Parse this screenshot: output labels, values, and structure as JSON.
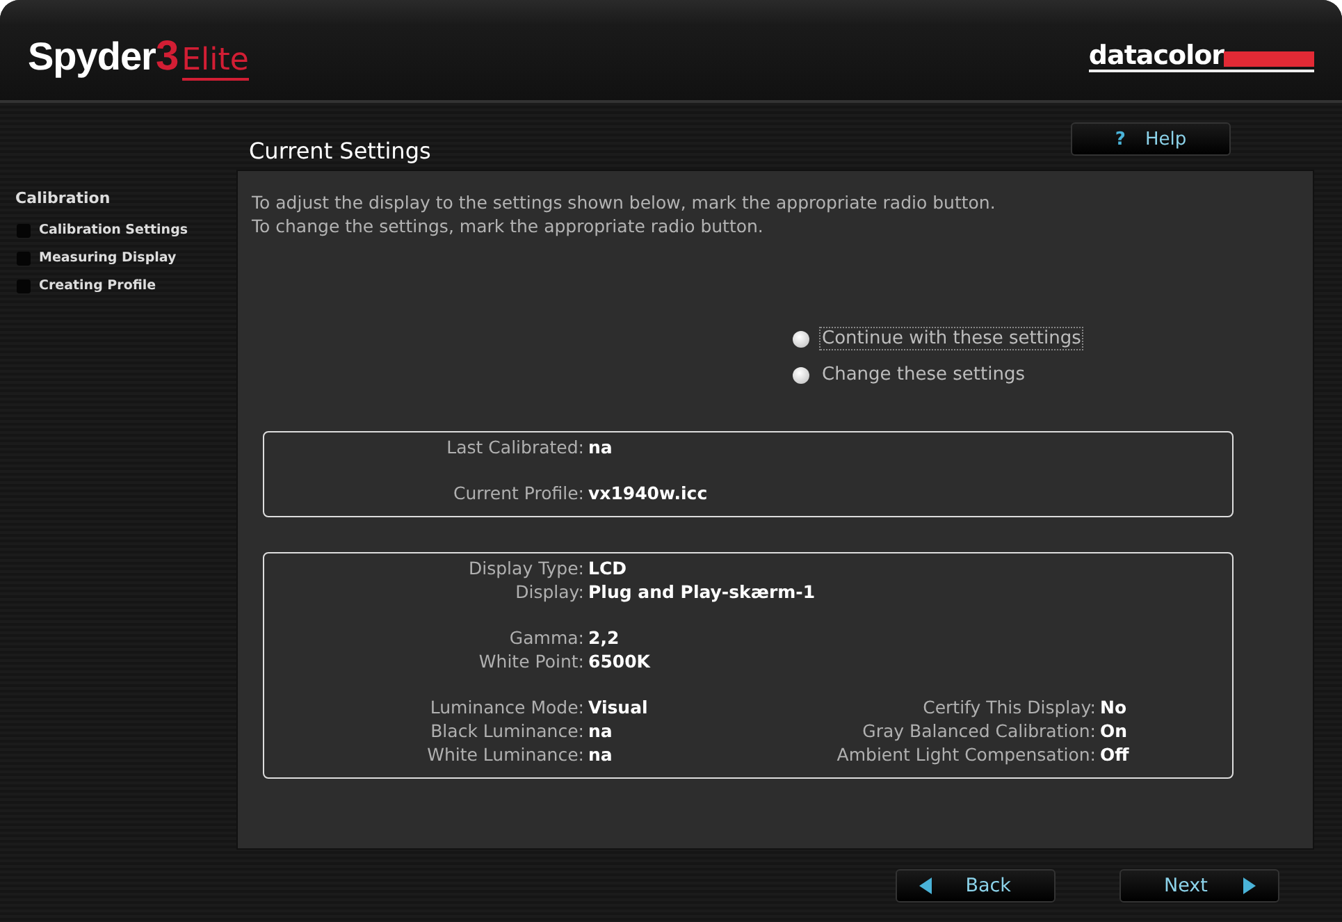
{
  "logo": {
    "product": "Spyder",
    "version": "3",
    "edition": "Elite"
  },
  "brand": "datacolor",
  "sidebar": {
    "heading": "Calibration",
    "items": [
      "Calibration Settings",
      "Measuring Display",
      "Creating Profile"
    ]
  },
  "page_title": "Current Settings",
  "help_button": {
    "icon": "?",
    "label": "Help"
  },
  "instructions": [
    "To adjust the display to the settings shown below, mark the appropriate radio button.",
    "To change the settings, mark the appropriate radio button."
  ],
  "options": [
    {
      "label": "Continue with these settings",
      "selected": false,
      "focused": true
    },
    {
      "label": "Change these settings",
      "selected": false,
      "focused": false
    }
  ],
  "info_boxes": [
    {
      "groups": [
        {
          "columns": [
            [
              {
                "label": "Last Calibrated:",
                "value": "na"
              }
            ]
          ]
        },
        {
          "columns": [
            [
              {
                "label": "Current Profile:",
                "value": "vx1940w.icc"
              }
            ]
          ]
        }
      ]
    },
    {
      "groups": [
        {
          "columns": [
            [
              {
                "label": "Display Type:",
                "value": "LCD"
              },
              {
                "label": "Display:",
                "value": "Plug and Play-skærm-1"
              }
            ]
          ]
        },
        {
          "columns": [
            [
              {
                "label": "Gamma:",
                "value": "2,2"
              },
              {
                "label": "White Point:",
                "value": "6500K"
              }
            ]
          ]
        },
        {
          "columns": [
            [
              {
                "label": "Luminance Mode:",
                "value": "Visual"
              },
              {
                "label": "Black Luminance:",
                "value": "na"
              },
              {
                "label": "White Luminance:",
                "value": "na"
              }
            ],
            [
              {
                "label": "Certify This Display:",
                "value": "No"
              },
              {
                "label": "Gray Balanced Calibration:",
                "value": "On"
              },
              {
                "label": "Ambient Light Compensation:",
                "value": "Off"
              }
            ]
          ]
        }
      ]
    }
  ],
  "nav_buttons": [
    {
      "kind": "back",
      "label": "Back"
    },
    {
      "kind": "next",
      "label": "Next"
    }
  ]
}
